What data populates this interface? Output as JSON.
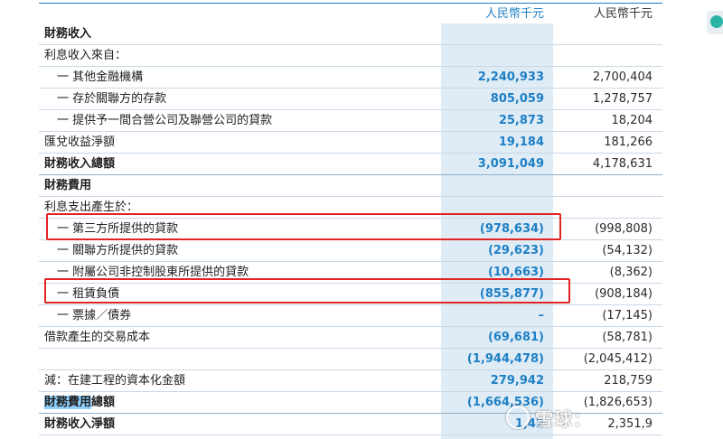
{
  "header": {
    "current_unit": "人民幣千元",
    "previous_unit": "人民幣千元"
  },
  "rows": [
    {
      "label": "財務收入",
      "current": "",
      "previous": "",
      "bold": true,
      "indent": false
    },
    {
      "label": "利息收入來自：",
      "current": "",
      "previous": "",
      "bold": false,
      "indent": false
    },
    {
      "label": "一 其他金融機構",
      "current": "2,240,933",
      "previous": "2,700,404",
      "bold": false,
      "indent": true
    },
    {
      "label": "一 存於關聯方的存款",
      "current": "805,059",
      "previous": "1,278,757",
      "bold": false,
      "indent": true
    },
    {
      "label": "一 提供予一間合營公司及聯營公司的貸款",
      "current": "25,873",
      "previous": "18,204",
      "bold": false,
      "indent": true
    },
    {
      "label": "匯兌收益淨額",
      "current": "19,184",
      "previous": "181,266",
      "bold": false,
      "indent": false
    },
    {
      "label": "財務收入總額",
      "current": "3,091,049",
      "previous": "4,178,631",
      "bold": true,
      "indent": false
    },
    {
      "label": "財務費用",
      "current": "",
      "previous": "",
      "bold": true,
      "indent": false
    },
    {
      "label": "利息支出產生於：",
      "current": "",
      "previous": "",
      "bold": false,
      "indent": false
    },
    {
      "label": "一 第三方所提供的貸款",
      "current": "(978,634)",
      "previous": "(998,808)",
      "bold": false,
      "indent": true
    },
    {
      "label": "一 關聯方所提供的貸款",
      "current": "(29,623)",
      "previous": "(54,132)",
      "bold": false,
      "indent": true
    },
    {
      "label": "一 附屬公司非控制股東所提供的貸款",
      "current": "(10,663)",
      "previous": "(8,362)",
      "bold": false,
      "indent": true
    },
    {
      "label": "一 租賃負債",
      "current": "(855,877)",
      "previous": "(908,184)",
      "bold": false,
      "indent": true
    },
    {
      "label": "一 票據／債券",
      "current": "–",
      "previous": "(17,145)",
      "bold": false,
      "indent": true
    },
    {
      "label": "借款產生的交易成本",
      "current": "(69,681)",
      "previous": "(58,781)",
      "bold": false,
      "indent": false
    },
    {
      "label": "",
      "current": "(1,944,478)",
      "previous": "(2,045,412)",
      "bold": false,
      "indent": false
    },
    {
      "label": "減：在建工程的資本化金額",
      "current": "279,942",
      "previous": "218,759",
      "bold": false,
      "indent": false
    },
    {
      "label_highlight": "財務費用",
      "label_rest": "總額",
      "current": "(1,664,536)",
      "previous": "(1,826,653)",
      "bold": true,
      "indent": false
    },
    {
      "label": "財務收入淨額",
      "current": "1,42",
      "previous": "2,351,9",
      "bold": true,
      "indent": false
    }
  ],
  "watermark": {
    "text": "雪球："
  },
  "colors": {
    "accent_blue": "#1d7fc4",
    "highlight_column": "#dfecf6",
    "annotation_red": "#e02424"
  }
}
